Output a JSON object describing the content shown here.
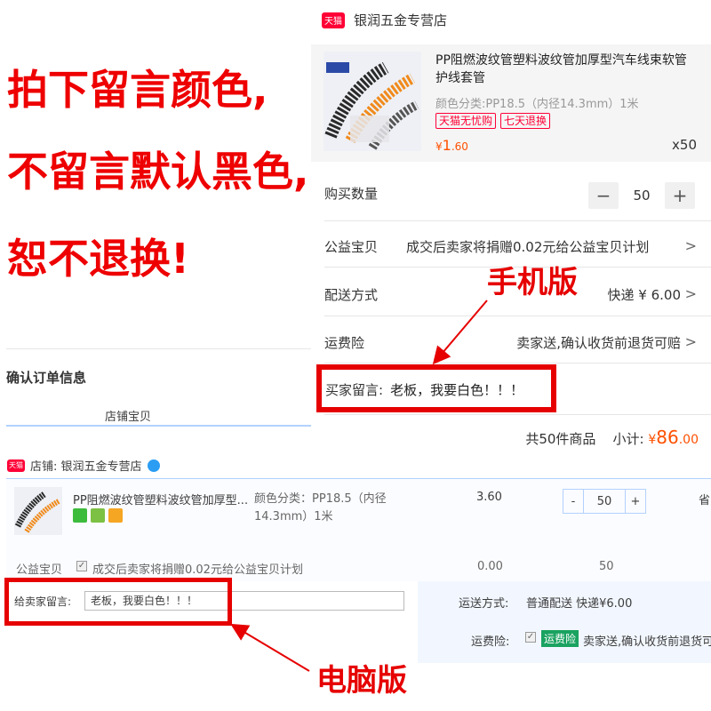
{
  "notice": {
    "line1": "拍下留言颜色,",
    "line2": "不留言默认黑色,",
    "line3": "恕不退换!"
  },
  "labels": {
    "mobile": "手机版",
    "desktop": "电脑版"
  },
  "mobile": {
    "shop_logo": "天猫",
    "shop_name": "银润五金专营店",
    "product": {
      "title": "PP阻燃波纹管塑料波纹管加厚型汽车线束软管护线套管",
      "spec": "颜色分类:PP18.5（内径14.3mm）1米",
      "tags": [
        "天猫无忧购",
        "七天退换"
      ],
      "price_symbol": "¥",
      "price_int": "1",
      "price_dec": ".60",
      "qty_text": "x50"
    },
    "quantity": {
      "label": "购买数量",
      "minus": "−",
      "value": "50",
      "plus": "+"
    },
    "charity": {
      "label": "公益宝贝",
      "value": "成交后卖家将捐赠0.02元给公益宝贝计划"
    },
    "delivery": {
      "label": "配送方式",
      "value": "快递 ¥ 6.00"
    },
    "insurance": {
      "label": "运费险",
      "value": "卖家送,确认收货前退货可赔"
    },
    "message": {
      "label": "买家留言:",
      "value": "老板，我要白色！！！"
    },
    "total": {
      "summary": "共50件商品",
      "label": "小计:",
      "symbol": "¥",
      "int": "86",
      "dec": ".00"
    }
  },
  "desktop": {
    "confirm_title": "确认订单信息",
    "shop_column": "店铺宝贝",
    "shop_logo": "天猫",
    "shop_label": "店铺: 银润五金专营店",
    "product": {
      "title": "PP阻燃波纹管塑料波纹管加厚型...",
      "spec": "颜色分类：PP18.5（内径14.3mm）1米",
      "unit_price": "3.60",
      "qty": "50",
      "minus": "-",
      "plus": "+",
      "next_col": "省"
    },
    "charity": {
      "label": "公益宝贝",
      "check": "✓",
      "text": "成交后卖家将捐赠0.02元给公益宝贝计划",
      "price": "0.00",
      "qty": "50"
    },
    "message": {
      "label": "给卖家留言:",
      "value": "老板，我要白色！！！"
    },
    "shipping": {
      "label": "运送方式:",
      "value": "普通配送 快递¥6.00"
    },
    "insurance": {
      "label": "运费险:",
      "check": "✓",
      "tag": "运费险",
      "text": "卖家送,确认收货前退货可"
    }
  },
  "colors": {
    "accent_red": "#e60000",
    "price_orange": "#ff5000",
    "tmall_red": "#ff0036"
  }
}
